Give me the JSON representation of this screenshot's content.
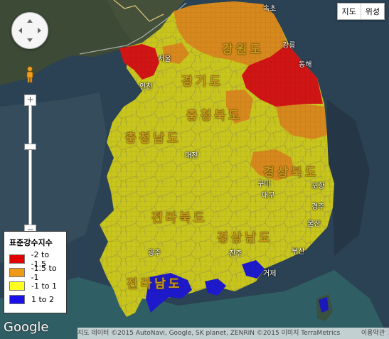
{
  "map_type_buttons": [
    "지도",
    "위성"
  ],
  "region_labels": {
    "gangwon": "강원도",
    "gyeonggi": "경기도",
    "chungbuk": "충청북도",
    "chungnam": "충청남도",
    "gyeongbuk": "경상북도",
    "jeonbuk": "전라북도",
    "gyeongnam": "경상남도",
    "jeonnam": "전라남도"
  },
  "city_labels": {
    "sokcho": "속초",
    "gangneung": "강릉",
    "donghae": "동해",
    "seoul": "서울",
    "incheon": "인천",
    "daejeon": "대전",
    "daegu": "대구",
    "gumi": "구미",
    "pohang": "포항",
    "gyeongju": "경주",
    "ulsan": "울산",
    "busan": "부산",
    "jinju": "진주",
    "gwangju": "광주",
    "geoje": "거제"
  },
  "legend": {
    "title": "표준강수지수",
    "items": [
      {
        "label": "-2 to -1.5",
        "color": "#e00000"
      },
      {
        "label": "-1.5 to -1",
        "color": "#ee9a18"
      },
      {
        "label": "-1 to 1",
        "color": "#ffff22"
      },
      {
        "label": "1 to 2",
        "color": "#1a10e8"
      }
    ]
  },
  "zoom": {
    "plus": "+",
    "minus": "−",
    "level_fraction": 0.33
  },
  "google_logo": "Google",
  "attribution": "지도 데이터 ©2015 AutoNavi, Google, SK planet, ZENRIN ©2015 이미지 TerraMetrics",
  "terms_link": "이용약관",
  "colors": {
    "severe_drought": "#d21414",
    "moderate_drought": "#d98b1c",
    "normal": "#cbc81e",
    "wet": "#1a18c8",
    "sea": "#2e4657"
  },
  "icons": [
    "pan-control-icon",
    "pegman-icon"
  ]
}
